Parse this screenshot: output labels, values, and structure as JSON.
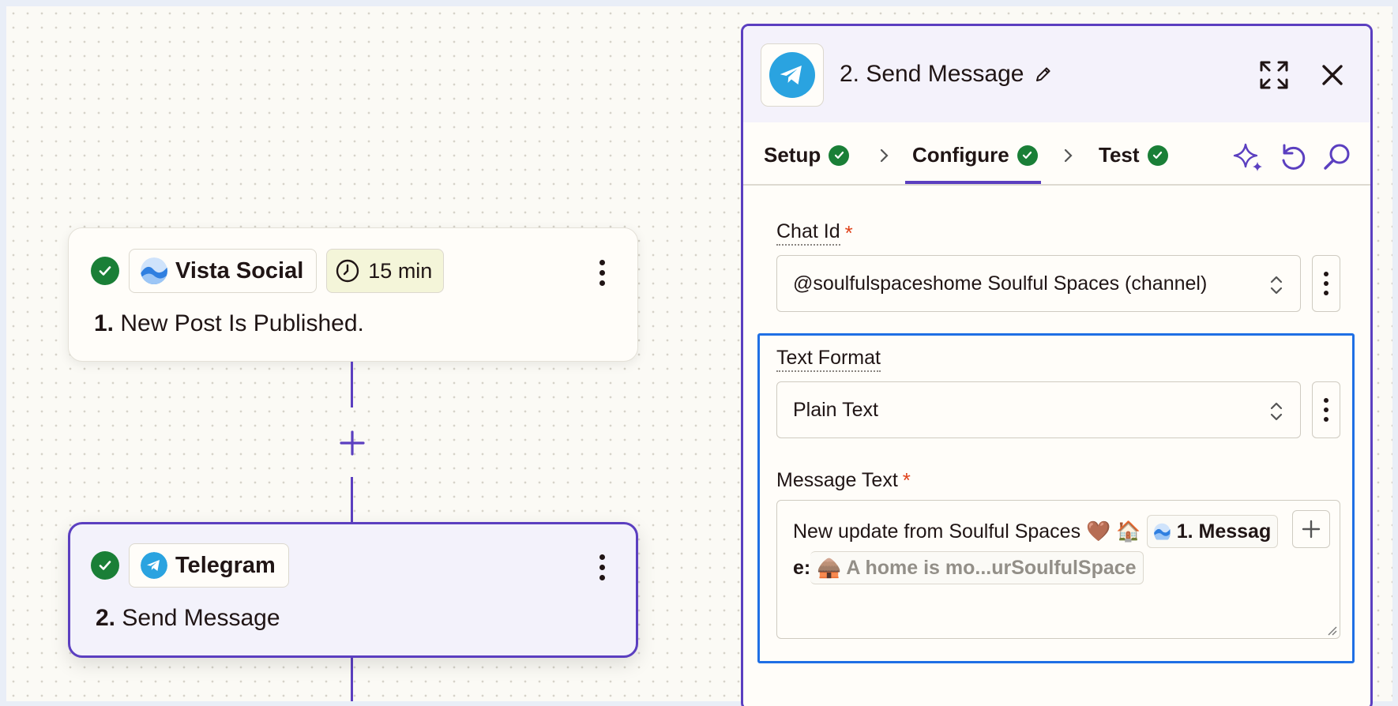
{
  "canvas": {
    "trigger_step": {
      "app_name": "Vista Social",
      "interval": "15 min",
      "step_number": "1.",
      "title": "New Post Is Published."
    },
    "action_step": {
      "app_name": "Telegram",
      "step_number": "2.",
      "title": "Send Message"
    }
  },
  "panel": {
    "title": "2. Send Message",
    "tabs": [
      {
        "label": "Setup"
      },
      {
        "label": "Configure"
      },
      {
        "label": "Test"
      }
    ],
    "active_tab": "Configure",
    "fields": {
      "chat_id": {
        "label": "Chat Id",
        "required": "*",
        "value": "@soulfulspaceshome Soulful Spaces (channel)"
      },
      "text_format": {
        "label": "Text Format",
        "value": "Plain Text"
      },
      "message_text": {
        "label": "Message Text",
        "required": "*",
        "static_text": "New update from Soulful Spaces 🤎 🏠",
        "field_pill_label": "1. Messag",
        "field_pill_cont": "e:",
        "field_pill_preview": "🛖 A home is mo...urSoulfulSpace"
      }
    }
  },
  "colors": {
    "brand_purple": "#5b3fc0",
    "success_green": "#1a7f37",
    "focus_blue": "#1f6fe5",
    "required_red": "#e0431b",
    "telegram_blue": "#2aa3e0"
  },
  "icons": [
    "check-circle-icon",
    "vista-social-icon",
    "clock-icon",
    "kebab-menu-icon",
    "plus-icon",
    "telegram-icon",
    "pencil-icon",
    "expand-icon",
    "close-icon",
    "chevron-right-icon",
    "sparkle-icon",
    "undo-icon",
    "search-icon",
    "updown-chevron-icon"
  ]
}
